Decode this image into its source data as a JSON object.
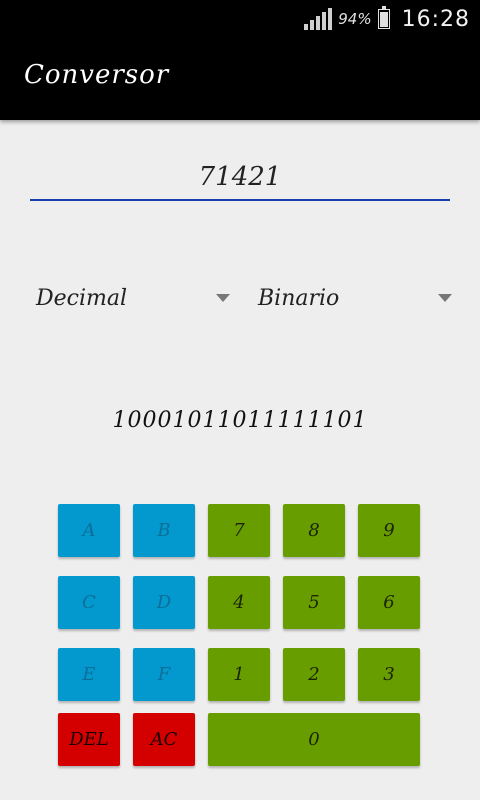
{
  "status_bar": {
    "battery": "94%",
    "time": "16:28"
  },
  "app_bar": {
    "title": "Conversor"
  },
  "input": {
    "value": "71421"
  },
  "from_spinner": {
    "selected": "Decimal"
  },
  "to_spinner": {
    "selected": "Binario"
  },
  "result": {
    "value": "10001011011111101"
  },
  "keypad": {
    "a": "A",
    "b": "B",
    "c": "C",
    "d": "D",
    "e": "E",
    "f": "F",
    "k7": "7",
    "k8": "8",
    "k9": "9",
    "k4": "4",
    "k5": "5",
    "k6": "6",
    "k1": "1",
    "k2": "2",
    "k3": "3",
    "k0": "0",
    "del": "DEL",
    "ac": "AC"
  },
  "colors": {
    "hex_keys": "#0399cf",
    "digit_keys": "#689d00",
    "action_keys": "#d40000",
    "input_underline": "#1a3cb0"
  }
}
